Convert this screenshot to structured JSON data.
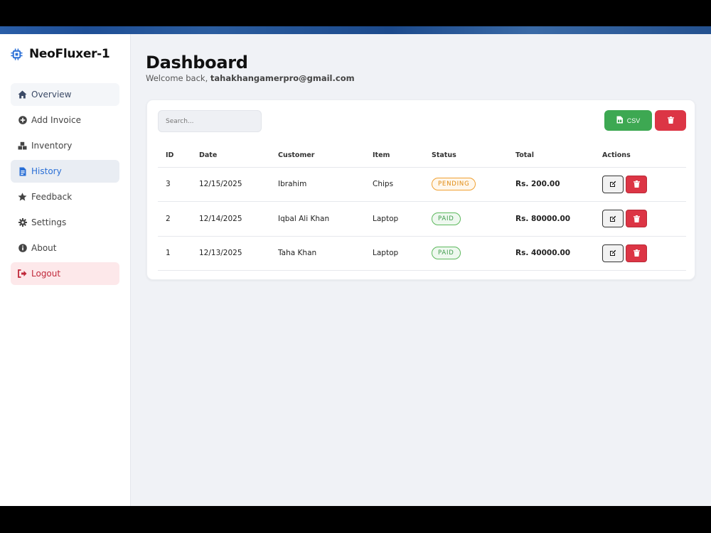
{
  "app": {
    "name": "NeoFluxer-1"
  },
  "sidebar": {
    "items": [
      {
        "label": "Overview",
        "icon": "home-icon"
      },
      {
        "label": "Add Invoice",
        "icon": "plus-circle-icon"
      },
      {
        "label": "Inventory",
        "icon": "boxes-icon"
      },
      {
        "label": "History",
        "icon": "file-invoice-icon"
      },
      {
        "label": "Feedback",
        "icon": "star-icon"
      },
      {
        "label": "Settings",
        "icon": "gear-icon"
      },
      {
        "label": "About",
        "icon": "info-icon"
      },
      {
        "label": "Logout",
        "icon": "logout-icon"
      }
    ]
  },
  "header": {
    "title": "Dashboard",
    "welcome_prefix": "Welcome back, ",
    "user_email": "tahakhangamerpro@gmail.com"
  },
  "toolbar": {
    "search_placeholder": "Search...",
    "csv_label": "CSV"
  },
  "table": {
    "headers": [
      "ID",
      "Date",
      "Customer",
      "Item",
      "Status",
      "Total",
      "Actions"
    ],
    "rows": [
      {
        "id": "3",
        "date": "12/15/2025",
        "customer": "Ibrahim",
        "item": "Chips",
        "status": "PENDING",
        "total": "Rs. 200.00"
      },
      {
        "id": "2",
        "date": "12/14/2025",
        "customer": "Iqbal Ali Khan",
        "item": "Laptop",
        "status": "PAID",
        "total": "Rs. 80000.00"
      },
      {
        "id": "1",
        "date": "12/13/2025",
        "customer": "Taha Khan",
        "item": "Laptop",
        "status": "PAID",
        "total": "Rs. 40000.00"
      }
    ]
  },
  "colors": {
    "accent": "#2a6fd6",
    "success": "#3da852",
    "danger": "#dc3545",
    "pending": "#e08a10"
  }
}
